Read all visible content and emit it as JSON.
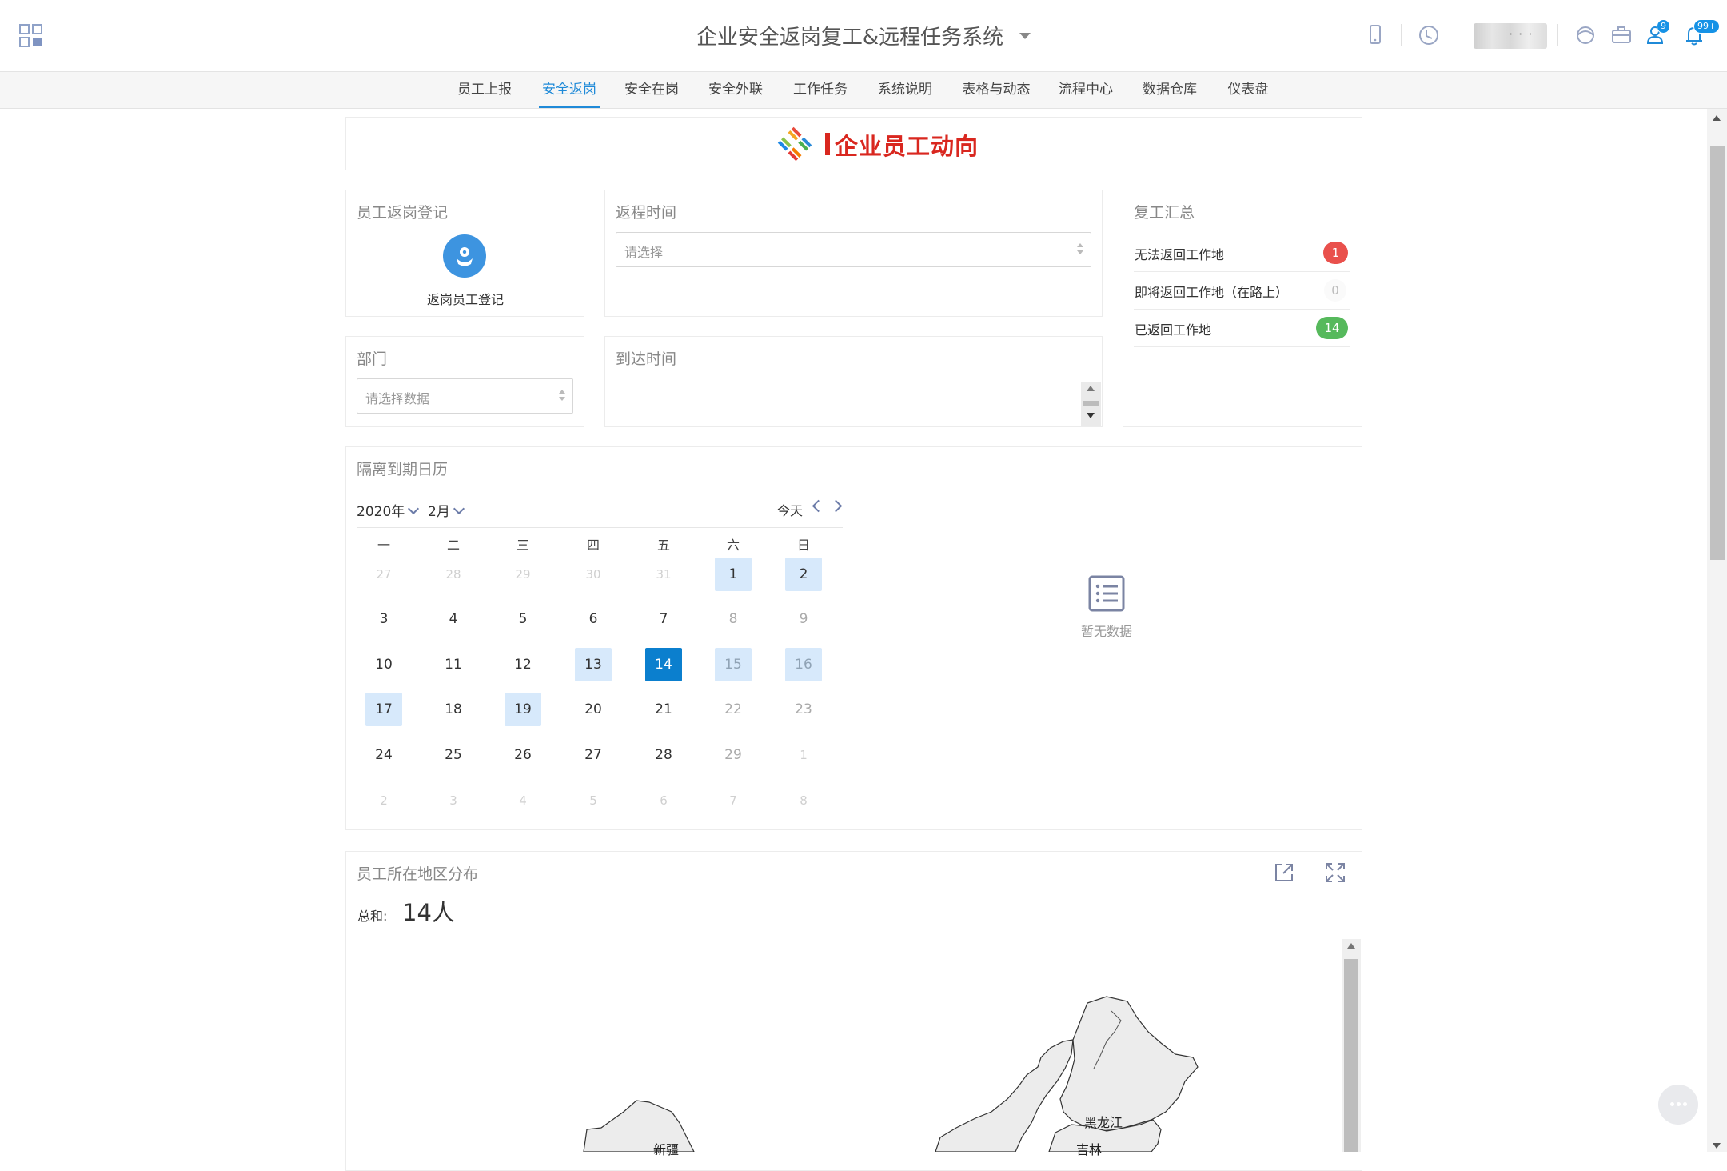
{
  "header": {
    "title": "企业安全返岗复工&远程任务系统",
    "user_name": "· · ·",
    "badges": {
      "messages": "9",
      "notifications": "99+"
    }
  },
  "nav": {
    "items": [
      "员工上报",
      "安全返岗",
      "安全在岗",
      "安全外联",
      "工作任务",
      "系统说明",
      "表格与动态",
      "流程中心",
      "数据仓库",
      "仪表盘"
    ],
    "active": "安全返岗"
  },
  "banner": {
    "text": "企业员工动向"
  },
  "register_card": {
    "title": "员工返岗登记",
    "button_label": "返岗员工登记"
  },
  "return_time_card": {
    "title": "返程时间",
    "placeholder": "请选择"
  },
  "department_card": {
    "title": "部门",
    "placeholder": "请选择数据"
  },
  "arrival_time_card": {
    "title": "到达时间"
  },
  "summary_card": {
    "title": "复工汇总",
    "rows": [
      {
        "label": "无法返回工作地",
        "count": "1",
        "color": "#e9504c"
      },
      {
        "label": "即将返回工作地（在路上）",
        "count": "0",
        "color": "#fafafa"
      },
      {
        "label": "已返回工作地",
        "count": "14",
        "color": "#56b95c"
      }
    ]
  },
  "calendar": {
    "title": "隔离到期日历",
    "year_label": "2020年",
    "month_label": "2月",
    "today_label": "今天",
    "weekdays": [
      "一",
      "二",
      "三",
      "四",
      "五",
      "六",
      "日"
    ],
    "weeks": [
      [
        "27",
        "28",
        "29",
        "30",
        "31",
        "1",
        "2"
      ],
      [
        "3",
        "4",
        "5",
        "6",
        "7",
        "8",
        "9"
      ],
      [
        "10",
        "11",
        "12",
        "13",
        "14",
        "15",
        "16"
      ],
      [
        "17",
        "18",
        "19",
        "20",
        "21",
        "22",
        "23"
      ],
      [
        "24",
        "25",
        "26",
        "27",
        "28",
        "29",
        "1"
      ],
      [
        "2",
        "3",
        "4",
        "5",
        "6",
        "7",
        "8"
      ]
    ],
    "highlighted_days": [
      "1",
      "2",
      "13",
      "15",
      "16",
      "17",
      "19"
    ],
    "selected_day": "14",
    "empty_text": "暂无数据"
  },
  "map_card": {
    "title": "员工所在地区分布",
    "total_label": "总和:",
    "total_value": "14人",
    "regions": [
      "新疆",
      "黑龙江",
      "吉林"
    ]
  }
}
